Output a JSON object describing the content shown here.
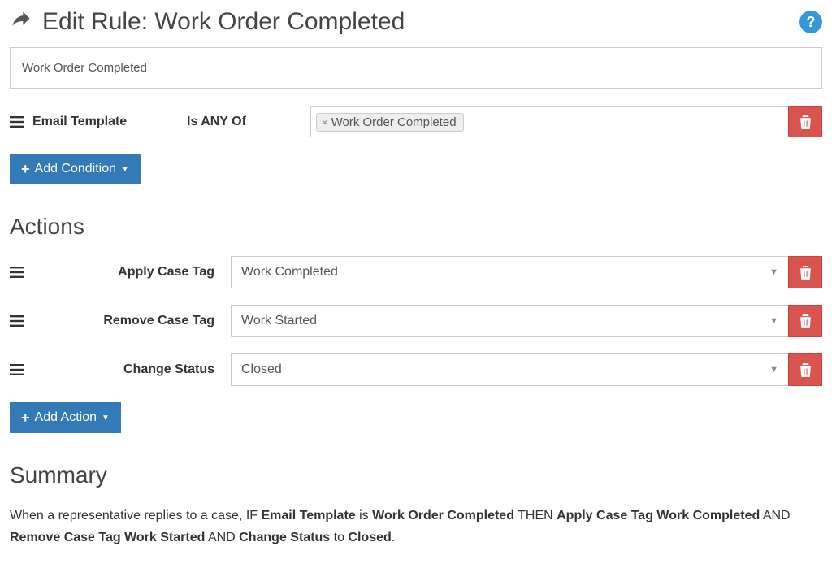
{
  "header": {
    "title": "Edit Rule: Work Order Completed"
  },
  "ruleName": "Work Order Completed",
  "condition": {
    "field": "Email Template",
    "operator": "Is ANY Of",
    "tokens": [
      "Work Order Completed"
    ]
  },
  "buttons": {
    "addCondition": "Add Condition",
    "addAction": "Add Action"
  },
  "sections": {
    "actions": "Actions",
    "summary": "Summary"
  },
  "actions": [
    {
      "label": "Apply Case Tag",
      "value": "Work Completed"
    },
    {
      "label": "Remove Case Tag",
      "value": "Work Started"
    },
    {
      "label": "Change Status",
      "value": "Closed"
    }
  ],
  "summary": {
    "prefix": "When a representative replies to a case, IF ",
    "p1b": "Email Template",
    "p2": " is ",
    "p2b": "Work Order Completed",
    "p3": " THEN ",
    "p3b": "Apply Case Tag Work Completed",
    "p4": " AND ",
    "p4b": "Remove Case Tag Work Started",
    "p5": " AND ",
    "p5b": "Change Status",
    "p6": " to ",
    "p6b": "Closed",
    "p7": "."
  }
}
